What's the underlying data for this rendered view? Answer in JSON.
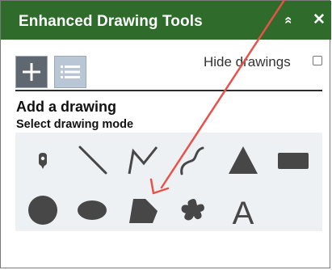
{
  "header": {
    "title": "Enhanced Drawing Tools",
    "collapse_glyph": "«",
    "close_glyph": "✕",
    "background_color": "#2f6b2a"
  },
  "tabs": [
    {
      "name": "add-drawing-tab",
      "icon": "plus-icon",
      "active": true
    },
    {
      "name": "drawing-list-tab",
      "icon": "list-icon",
      "active": false
    }
  ],
  "hide_drawings": {
    "label": "Hide drawings",
    "checked": false
  },
  "section": {
    "heading": "Add a drawing",
    "subheading": "Select drawing mode"
  },
  "tools": [
    {
      "icon": "point-icon"
    },
    {
      "icon": "line-icon"
    },
    {
      "icon": "polyline-icon"
    },
    {
      "icon": "freehand-line-icon"
    },
    {
      "icon": "triangle-icon"
    },
    {
      "icon": "rectangle-icon"
    },
    {
      "icon": "circle-icon"
    },
    {
      "icon": "ellipse-icon"
    },
    {
      "icon": "polygon-icon"
    },
    {
      "icon": "freehand-polygon-icon"
    },
    {
      "icon": "text-icon",
      "glyph": "A"
    }
  ],
  "annotation": {
    "type": "arrow",
    "color": "#e8524a"
  }
}
